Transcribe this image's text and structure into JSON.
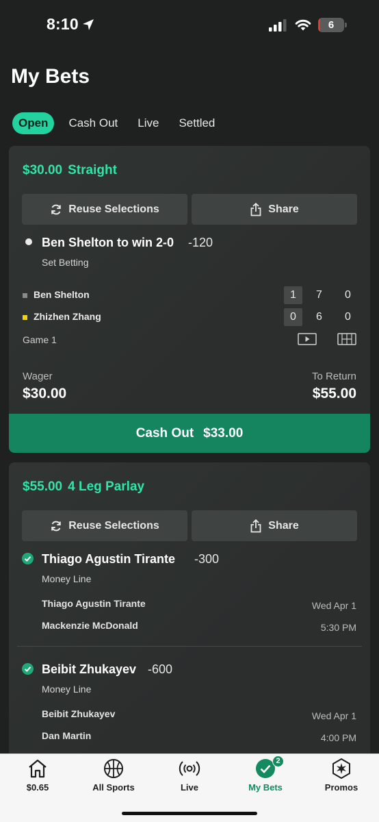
{
  "status_bar": {
    "time": "8:10",
    "battery": "6",
    "battery_level_percent": 6
  },
  "page": {
    "title": "My Bets"
  },
  "tabs": [
    {
      "label": "Open",
      "active": true
    },
    {
      "label": "Cash Out",
      "active": false
    },
    {
      "label": "Live",
      "active": false
    },
    {
      "label": "Settled",
      "active": false
    }
  ],
  "colors": {
    "accent": "#2ee6a9",
    "cashout": "#14855f",
    "background": "#1f2120",
    "card": "#2c302f"
  },
  "bets": [
    {
      "stake": "$30.00",
      "type": "Straight",
      "reuse_label": "Reuse Selections",
      "share_label": "Share",
      "selection": {
        "name": "Ben Shelton to win 2-0",
        "odds": "-120",
        "market": "Set Betting"
      },
      "scoreboard": {
        "players": [
          {
            "name": "Ben Shelton",
            "scores": [
              "1",
              "7",
              "0"
            ],
            "marker_color": "#8a8a8a"
          },
          {
            "name": "Zhizhen Zhang",
            "scores": [
              "0",
              "6",
              "0"
            ],
            "marker_color": "#f0d21c"
          }
        ],
        "game": "Game 1"
      },
      "wager_label": "Wager",
      "wager": "$30.00",
      "return_label": "To Return",
      "to_return": "$55.00",
      "cashout_label": "Cash Out",
      "cashout_amount": "$33.00"
    },
    {
      "stake": "$55.00",
      "type": "4 Leg Parlay",
      "reuse_label": "Reuse Selections",
      "share_label": "Share",
      "legs": [
        {
          "name": "Thiago Agustin Tirante",
          "odds": "-300",
          "market": "Money Line",
          "player1": "Thiago Agustin Tirante",
          "player2": "Mackenzie McDonald",
          "date": "Wed Apr 1",
          "time": "5:30 PM"
        },
        {
          "name": "Beibit Zhukayev",
          "odds": "-600",
          "market": "Money Line",
          "player1": "Beibit Zhukayev",
          "player2": "Dan Martin",
          "date": "Wed Apr 1",
          "time": "4:00 PM"
        }
      ]
    }
  ],
  "bottom_nav": [
    {
      "label": "$0.65",
      "icon": "home-icon"
    },
    {
      "label": "All Sports",
      "icon": "basketball-icon"
    },
    {
      "label": "Live",
      "icon": "broadcast-icon"
    },
    {
      "label": "My Bets",
      "icon": "check-circle-icon",
      "badge": "2",
      "active": true
    },
    {
      "label": "Promos",
      "icon": "star-badge-icon"
    }
  ]
}
